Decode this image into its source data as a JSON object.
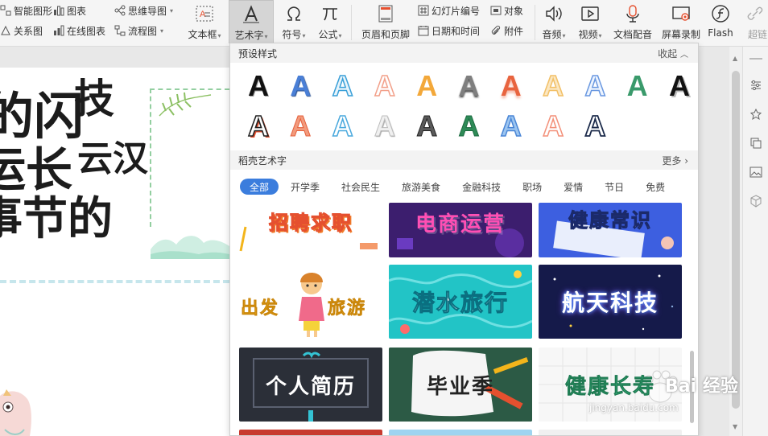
{
  "ribbon": {
    "smart_graphic": "智能图形",
    "chart": "图表",
    "mind_map": "思维导图",
    "relation_map": "关系图",
    "online_chart": "在线图表",
    "flowchart": "流程图",
    "textbox": "文本框",
    "wordart": "艺术字",
    "symbol": "符号",
    "formula": "公式",
    "header_footer": "页眉和页脚",
    "slide_number": "幻灯片编号",
    "object": "对象",
    "date_time": "日期和时间",
    "attachment": "附件",
    "audio": "音频",
    "video": "视频",
    "doc_dub": "文档配音",
    "screen_record": "屏幕录制",
    "flash": "Flash",
    "super_link": "超链"
  },
  "slide": {
    "calligraphy_lines": [
      "的闪",
      "运长",
      "事节的",
      "云汉",
      "技"
    ]
  },
  "panel": {
    "preset_title": "预设样式",
    "collapse": "收起",
    "preset_glyph": "A",
    "gallery_title": "稻壳艺术字",
    "more": "更多",
    "tabs": [
      "全部",
      "开学季",
      "社会民生",
      "旅游美食",
      "金融科技",
      "职场",
      "爱情",
      "节日",
      "免费"
    ],
    "cards": [
      {
        "text": "招聘求职",
        "bg": "#ffffff",
        "fg": "#f07a2a"
      },
      {
        "text": "电商运营",
        "bg": "#3c1e6e",
        "fg": "#ff4fb4"
      },
      {
        "text": "健康常识",
        "bg": "#3d5fe0",
        "fg": "#ffffff"
      },
      {
        "text": "出发",
        "text2": "旅游",
        "bg": "#ffffff",
        "fg": "#f3b51b"
      },
      {
        "text": "潜水旅行",
        "bg": "#20c7c9",
        "fg": "#ffffff"
      },
      {
        "text": "航天科技",
        "bg": "#151a4a",
        "fg": "#ffffff"
      },
      {
        "text": "个人简历",
        "bg": "#2b2f38",
        "fg": "#ffffff"
      },
      {
        "text": "毕业季",
        "bg": "#2a4a3c",
        "fg": "#222222"
      },
      {
        "text": "健康长寿",
        "bg": "#f7f7f7",
        "fg": "#35b07a"
      }
    ]
  },
  "watermark": {
    "text": "Bai 经验",
    "url": "jingyan.baidu.com"
  }
}
